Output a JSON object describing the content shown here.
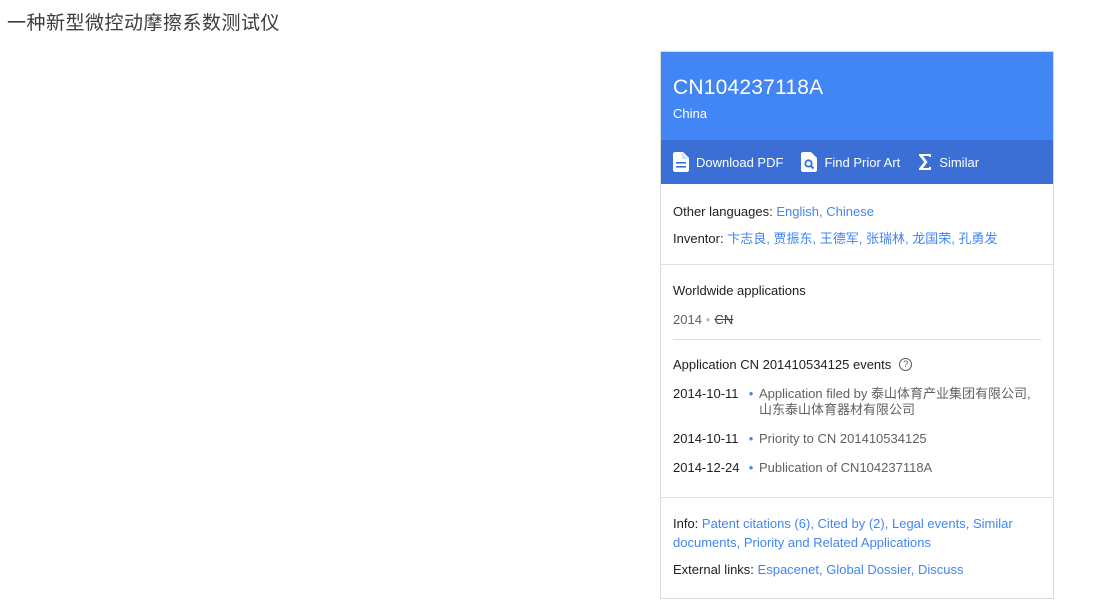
{
  "page": {
    "title": "一种新型微控动摩擦系数测试仪"
  },
  "card": {
    "publication_number": "CN104237118A",
    "country": "China",
    "toolbar": {
      "download_pdf": "Download PDF",
      "find_prior_art": "Find Prior Art",
      "similar": "Similar"
    },
    "other_languages": {
      "label": "Other languages:",
      "links": [
        "English",
        "Chinese"
      ]
    },
    "inventor": {
      "label": "Inventor:",
      "names": [
        "卞志良",
        "贾振东",
        "王德军",
        "张瑞林",
        "龙国荣",
        "孔勇发"
      ]
    },
    "worldwide": {
      "title": "Worldwide applications",
      "year": "2014",
      "country": "CN"
    },
    "events_title": "Application CN 201410534125 events",
    "events": [
      {
        "date": "2014-10-11",
        "text": "Application filed by 泰山体育产业集团有限公司, 山东泰山体育器材有限公司"
      },
      {
        "date": "2014-10-11",
        "text": "Priority to CN 201410534125"
      },
      {
        "date": "2014-12-24",
        "text": "Publication of CN104237118A"
      }
    ],
    "info": {
      "label": "Info:",
      "links": [
        "Patent citations (6)",
        "Cited by (2)",
        "Legal events",
        "Similar documents",
        "Priority and Related Applications"
      ]
    },
    "external": {
      "label": "External links:",
      "links": [
        "Espacenet",
        "Global Dossier",
        "Discuss"
      ]
    }
  },
  "colors": {
    "header": "#4285f4",
    "toolbar": "#3b6fd6",
    "link": "#4285f4"
  },
  "icons": [
    "document-pdf-icon",
    "search-document-icon",
    "sigma-icon",
    "help-icon"
  ]
}
